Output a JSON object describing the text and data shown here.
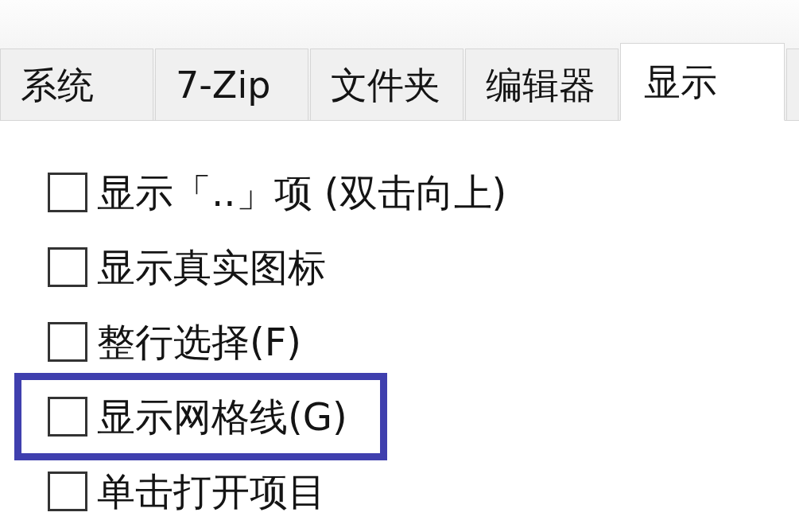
{
  "tabs": [
    {
      "label": "系统",
      "selected": false
    },
    {
      "label": "7-Zip",
      "selected": false
    },
    {
      "label": "文件夹",
      "selected": false
    },
    {
      "label": "编辑器",
      "selected": false
    },
    {
      "label": "显示",
      "selected": true
    },
    {
      "selected": false
    }
  ],
  "options": [
    {
      "label": "显示「..」项 (双击向上)",
      "checked": false,
      "highlighted": false
    },
    {
      "label": "显示真实图标",
      "checked": false,
      "highlighted": false
    },
    {
      "label": "整行选择(F)",
      "checked": false,
      "highlighted": false
    },
    {
      "label": "显示网格线(G)",
      "checked": false,
      "highlighted": true
    },
    {
      "label": "单击打开项目",
      "checked": false,
      "highlighted": false
    }
  ]
}
